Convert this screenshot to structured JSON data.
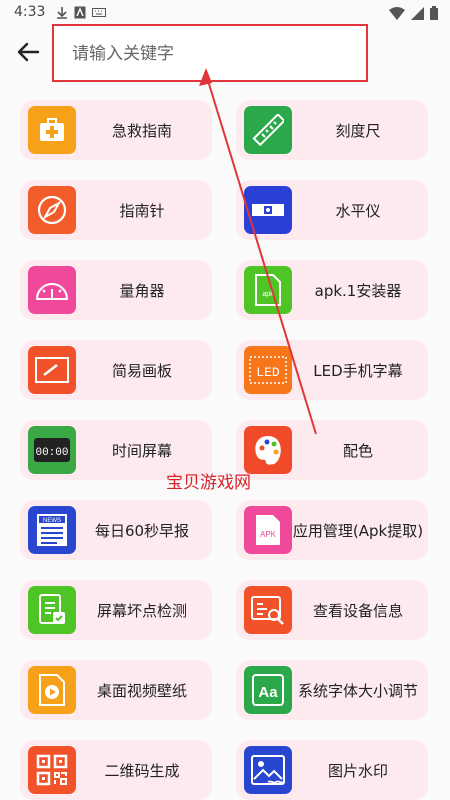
{
  "status_bar": {
    "time": "4:33"
  },
  "search": {
    "placeholder": "请输入关键字",
    "value": ""
  },
  "watermark": "宝贝游戏网",
  "colors": {
    "search_border": "#e0353a",
    "card_bg": "#fceaee",
    "watermark": "#d8222a"
  },
  "tools": [
    {
      "label": "急救指南",
      "icon": "first-aid-kit-icon",
      "color": "#f7a11a"
    },
    {
      "label": "刻度尺",
      "icon": "ruler-icon",
      "color": "#2aa84a"
    },
    {
      "label": "指南针",
      "icon": "compass-icon",
      "color": "#f25b2a"
    },
    {
      "label": "水平仪",
      "icon": "level-icon",
      "color": "#2a3fd6"
    },
    {
      "label": "量角器",
      "icon": "protractor-icon",
      "color": "#f0489a"
    },
    {
      "label": "apk.1安装器",
      "icon": "apk-file-icon",
      "color": "#4fc425"
    },
    {
      "label": "简易画板",
      "icon": "drawing-board-icon",
      "color": "#f2522a"
    },
    {
      "label": "LED手机字幕",
      "icon": "led-sign-icon",
      "color": "#f7761a"
    },
    {
      "label": "时间屏幕",
      "icon": "digital-clock-icon",
      "color": "#3aa845"
    },
    {
      "label": "配色",
      "icon": "palette-icon",
      "color": "#f04a2a"
    },
    {
      "label": "每日60秒早报",
      "icon": "newspaper-icon",
      "color": "#2846cf"
    },
    {
      "label": "应用管理(Apk提取)",
      "icon": "apk-manager-icon",
      "color": "#f0489a"
    },
    {
      "label": "屏幕坏点检测",
      "icon": "document-check-icon",
      "color": "#4fc425"
    },
    {
      "label": "查看设备信息",
      "icon": "device-info-icon",
      "color": "#f2522a"
    },
    {
      "label": "桌面视频壁纸",
      "icon": "video-wallpaper-icon",
      "color": "#f7a11a"
    },
    {
      "label": "系统字体大小调节",
      "icon": "font-size-icon",
      "color": "#2aa84a"
    },
    {
      "label": "二维码生成",
      "icon": "qr-code-icon",
      "color": "#f2522a"
    },
    {
      "label": "图片水印",
      "icon": "image-watermark-icon",
      "color": "#2846cf"
    }
  ]
}
